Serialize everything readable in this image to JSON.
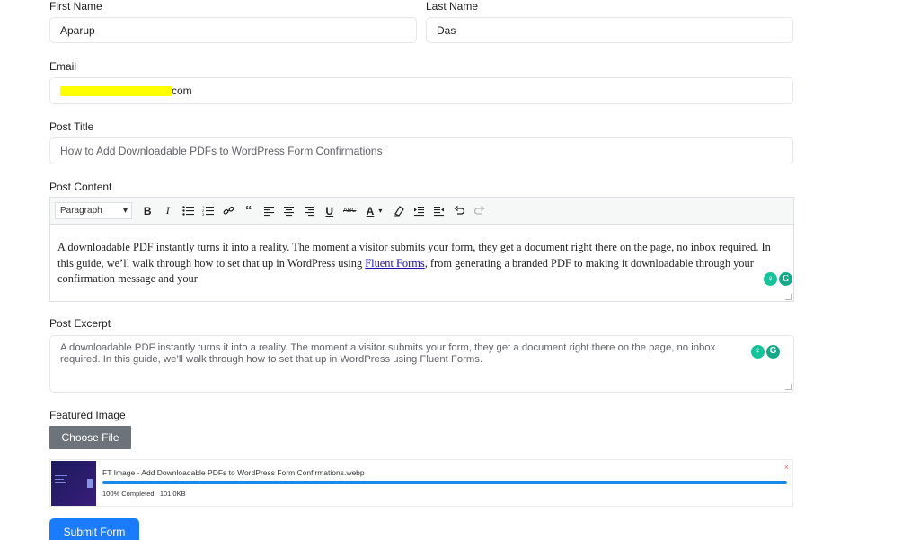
{
  "form": {
    "first_name": {
      "label": "First Name",
      "value": "Aparup"
    },
    "last_name": {
      "label": "Last Name",
      "value": "Das"
    },
    "email": {
      "label": "Email",
      "value_visible_suffix": "com"
    },
    "post_title": {
      "label": "Post Title",
      "value": "How to Add Downloadable PDFs to WordPress Form Confirmations"
    },
    "post_content": {
      "label": "Post Content",
      "format_select": "Paragraph",
      "text_before_link": "A downloadable PDF instantly turns it into a reality. The moment a visitor submits your form, they get a document right there on the page, no inbox required. In this guide, we’ll walk through how to set that up in WordPress using ",
      "link_text": "Fluent Forms",
      "text_after_link": ", from generating a branded PDF to making it downloadable through your confirmation message and your"
    },
    "post_excerpt": {
      "label": "Post Excerpt",
      "value": "A downloadable PDF instantly turns it into a reality. The moment a visitor submits your form, they get a document right there on the page, no inbox required. In this guide, we’ll walk through how to set that up in WordPress using Fluent Forms."
    },
    "featured_image": {
      "label": "Featured Image",
      "choose_button": "Choose File",
      "file_name": "FT Image - Add Downloadable PDFs to WordPress Form Confirmations.webp",
      "status": "100% Completed",
      "size": "101.0KB",
      "progress": 100,
      "remove_symbol": "×"
    },
    "submit_label": "Submit Form"
  },
  "toolbar_icons": [
    "bold-icon",
    "italic-icon",
    "bullet-list-icon",
    "numbered-list-icon",
    "link-icon",
    "blockquote-icon",
    "align-left-icon",
    "align-center-icon",
    "align-right-icon",
    "underline-icon",
    "strikethrough-icon",
    "text-color-icon",
    "clear-formatting-icon",
    "indent-icon",
    "outdent-icon",
    "undo-icon",
    "redo-icon"
  ],
  "colors": {
    "submit_button": "#1a7cfc",
    "choose_button": "#6d737a",
    "progress_fill": "#1e88e5",
    "email_redaction": "#ffff00",
    "grammarly": "#15c39a"
  }
}
